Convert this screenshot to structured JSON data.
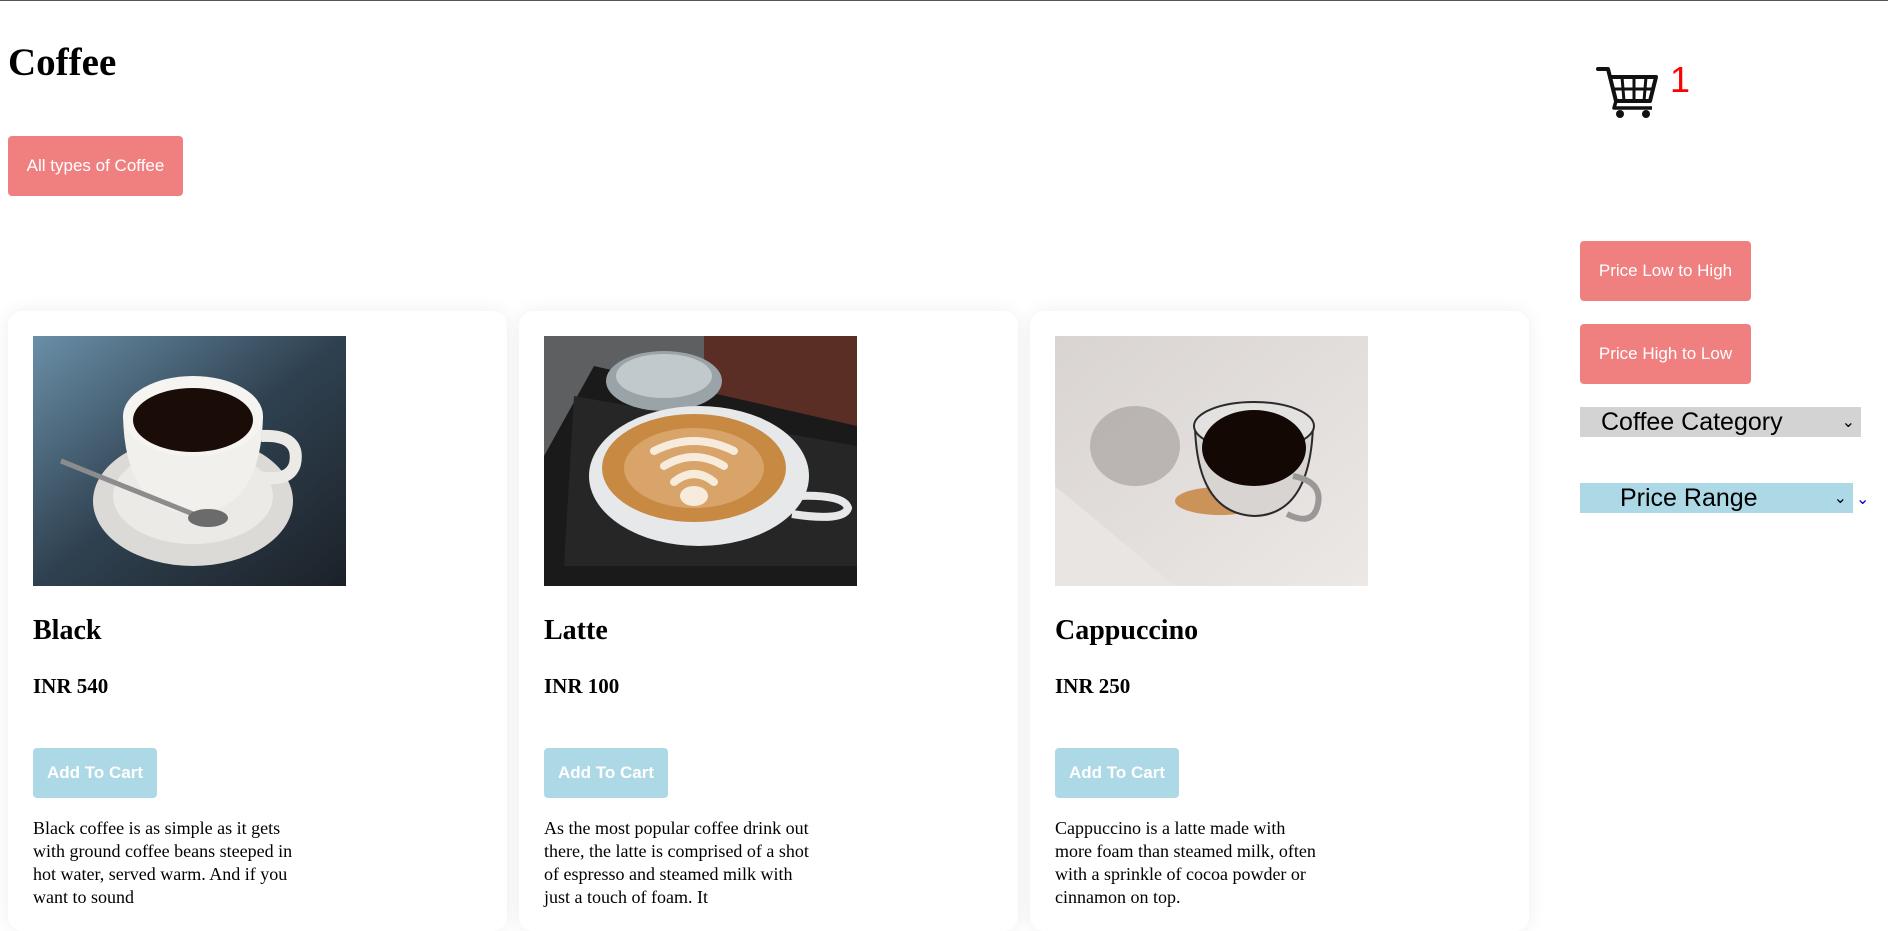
{
  "page": {
    "title": "Coffee"
  },
  "filters": {
    "all_types_label": "All types of Coffee",
    "sort_low_high_label": "Price Low to High",
    "sort_high_low_label": "Price High to Low",
    "category_select": "Coffee Category",
    "price_range_select": "Price Range"
  },
  "cart": {
    "count": "1",
    "icon": "shopping-cart-icon"
  },
  "products": [
    {
      "name": "Black",
      "price": "INR 540",
      "add_label": "Add To Cart",
      "description": "Black coffee is as simple as it gets with ground coffee beans steeped in hot water, served warm. And if you want to sound"
    },
    {
      "name": "Latte",
      "price": "INR 100",
      "add_label": "Add To Cart",
      "description": "As the most popular coffee drink out there, the latte is comprised of a shot of espresso and steamed milk with just a touch of foam. It"
    },
    {
      "name": "Cappuccino",
      "price": "INR 250",
      "add_label": "Add To Cart",
      "description": "Cappuccino is a latte made with more foam than steamed milk, often with a sprinkle of cocoa powder or cinnamon on top."
    }
  ],
  "colors": {
    "pink_button": "#f08080",
    "add_to_cart": "#add8e6",
    "cart_count": "#ff0000",
    "category_select_bg": "#d3d3d3",
    "price_select_bg": "#add8e6"
  }
}
